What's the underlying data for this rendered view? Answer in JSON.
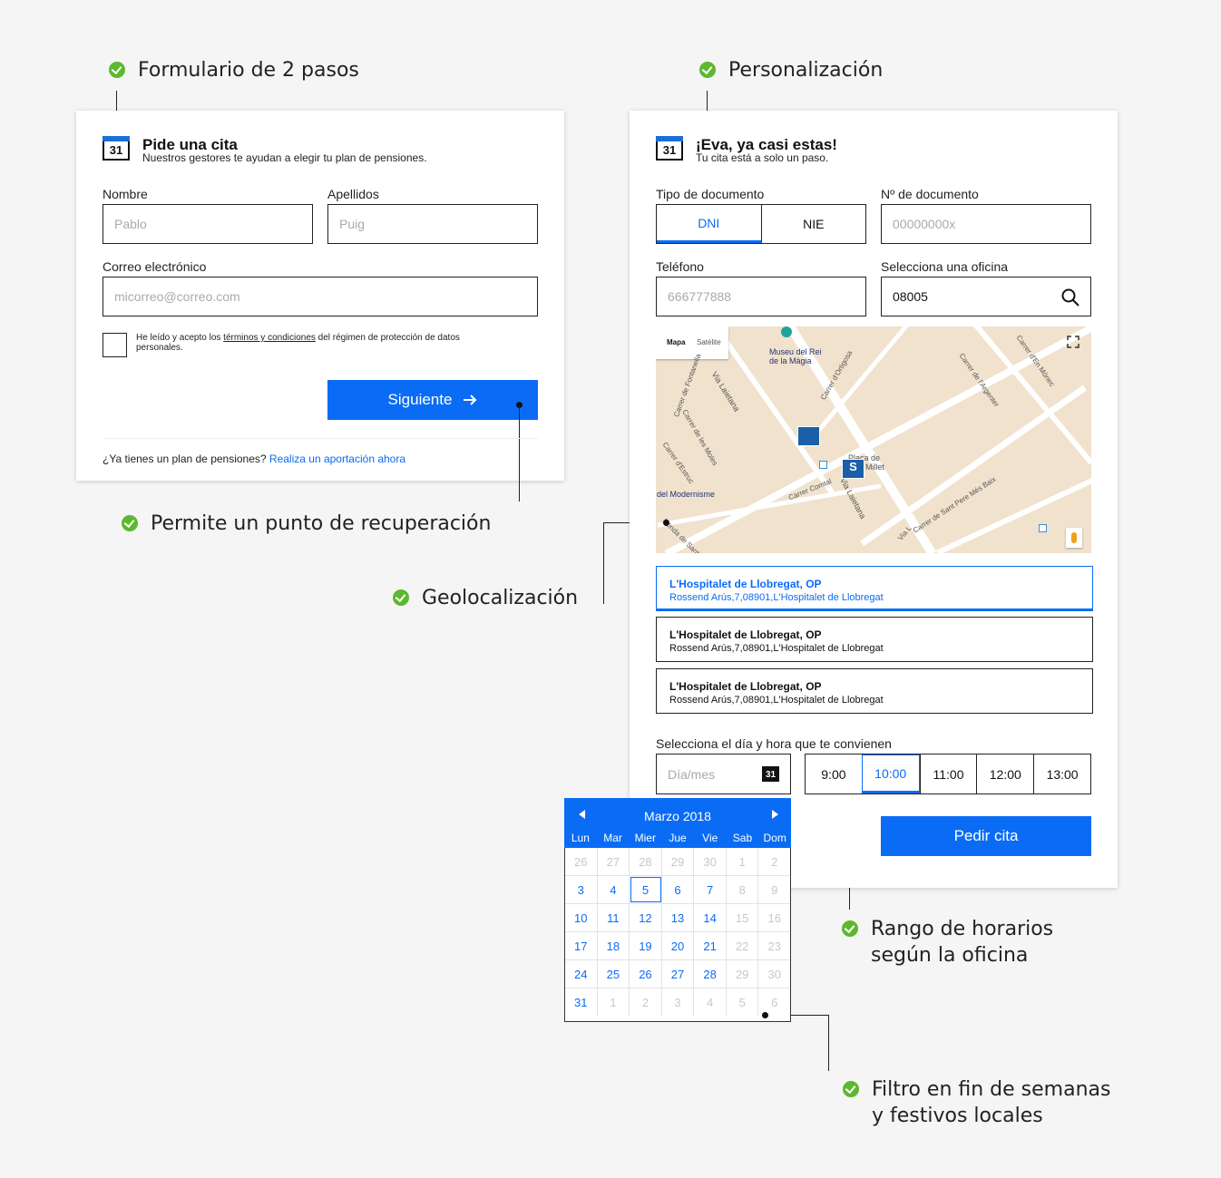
{
  "annotations": {
    "form_steps": "Formulario de 2 pasos",
    "personalization": "Personalización",
    "recovery": "Permite un punto de recuperación",
    "geolocation": "Geolocalización",
    "hours_line1": "Rango de horarios",
    "hours_line2": "según la oficina",
    "filter_line1": "Filtro en fin de semanas",
    "filter_line2": "y festivos locales"
  },
  "step1": {
    "calendar_icon_day": "31",
    "title": "Pide una cita",
    "subtitle": "Nuestros gestores te ayudan a elegir tu plan de pensiones.",
    "name_label": "Nombre",
    "name_placeholder": "Pablo",
    "surname_label": "Apellidos",
    "surname_placeholder": "Puig",
    "email_label": "Correo electrónico",
    "email_placeholder": "micorreo@correo.com",
    "terms_pre": "He leído y acepto los",
    "terms_link": "términos y condiciones",
    "terms_post": "del régimen de protección de datos",
    "terms_post2": "personales.",
    "next_button": "Siguiente",
    "footer_question": "¿Ya tienes un plan de pensiones?",
    "footer_link": "Realiza un aportación ahora"
  },
  "step2": {
    "calendar_icon_day": "31",
    "title": "¡Eva, ya casi estas!",
    "subtitle": "Tu cita está a solo un paso.",
    "doc_type_label": "Tipo de documento",
    "doc_type_options": [
      "DNI",
      "NIE"
    ],
    "doc_type_selected": "DNI",
    "doc_number_label": "Nº de documento",
    "doc_number_placeholder": "00000000x",
    "phone_label": "Teléfono",
    "phone_placeholder": "666777888",
    "office_label": "Selecciona una oficina",
    "office_value": "08005",
    "map": {
      "tab_map": "Mapa",
      "tab_satellite": "Satélite",
      "labels": [
        "Museu del Rei",
        "de la Màgia",
        "Via Laietana",
        "Carrer de Fontanella",
        "Carrer d'Ortigosa",
        "Carrer de les Moles",
        "Carrer d'Estruc",
        "Plaça de",
        "Millet",
        "Carrer Comtal",
        "Via Laietana",
        "del Modernisme",
        "Carrer de Sant Pere Més Baix",
        "Carrer de l'Argenter",
        "Carrer d'En Mònec",
        "Via L",
        "Ronda de Sant Pere"
      ]
    },
    "offices": [
      {
        "name": "L'Hospitalet de Llobregat, OP",
        "address": "Rossend Arús,7,08901,L'Hospitalet de Llobregat",
        "selected": true
      },
      {
        "name": "L'Hospitalet de Llobregat, OP",
        "address": "Rossend Arús,7,08901,L'Hospitalet de Llobregat",
        "selected": false
      },
      {
        "name": "L'Hospitalet de Llobregat, OP",
        "address": "Rossend Arús,7,08901,L'Hospitalet de Llobregat",
        "selected": false
      }
    ],
    "datetime_label": "Selecciona el día y hora que te convienen",
    "date_placeholder": "Día/mes",
    "date_icon_day": "31",
    "hours": [
      "9:00",
      "10:00",
      "11:00",
      "12:00",
      "13:00"
    ],
    "hour_selected": "10:00",
    "submit_button": "Pedir cita"
  },
  "calendar": {
    "month": "Marzo 2018",
    "weekdays": [
      "Lun",
      "Mar",
      "Mier",
      "Jue",
      "Vie",
      "Sab",
      "Dom"
    ],
    "weeks": [
      [
        "26",
        "27",
        "28",
        "29",
        "30",
        "1",
        "2"
      ],
      [
        "3",
        "4",
        "5",
        "6",
        "7",
        "8",
        "9"
      ],
      [
        "10",
        "11",
        "12",
        "13",
        "14",
        "15",
        "16"
      ],
      [
        "17",
        "18",
        "19",
        "20",
        "21",
        "22",
        "23"
      ],
      [
        "24",
        "25",
        "26",
        "27",
        "28",
        "29",
        "30"
      ],
      [
        "31",
        "1",
        "2",
        "3",
        "4",
        "5",
        "6"
      ]
    ],
    "enabled": [
      [
        false,
        false,
        false,
        false,
        false,
        false,
        false
      ],
      [
        true,
        true,
        true,
        true,
        true,
        false,
        false
      ],
      [
        true,
        true,
        true,
        true,
        true,
        false,
        false
      ],
      [
        true,
        true,
        true,
        true,
        true,
        false,
        false
      ],
      [
        true,
        true,
        true,
        true,
        true,
        false,
        false
      ],
      [
        true,
        false,
        false,
        false,
        false,
        false,
        false
      ]
    ],
    "selected": "5"
  },
  "colors": {
    "accent": "#0a6cf5",
    "check": "#5cb82e",
    "disabled": "#c8c8c8"
  }
}
